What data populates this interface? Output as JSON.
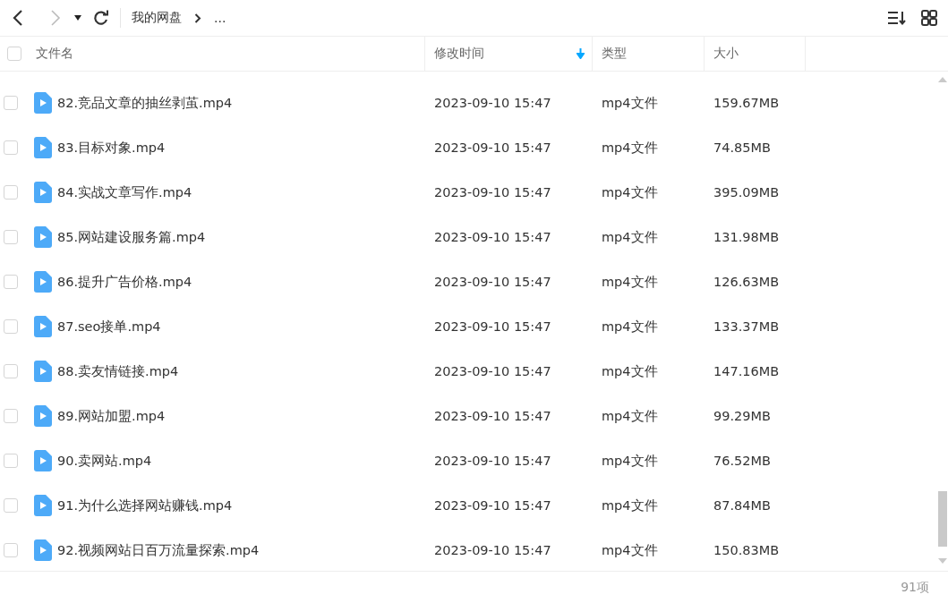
{
  "toolbar": {
    "back_disabled": false,
    "forward_disabled": true,
    "breadcrumb": [
      "我的网盘",
      "..."
    ]
  },
  "columns": [
    {
      "label": "文件名",
      "sorted": false
    },
    {
      "label": "修改时间",
      "sorted": true
    },
    {
      "label": "类型",
      "sorted": false
    },
    {
      "label": "大小",
      "sorted": false
    }
  ],
  "rows": [
    {
      "name": "82.竞品文章的抽丝剥茧.mp4",
      "modified": "2023-09-10 15:47",
      "type": "mp4文件",
      "size": "159.67MB",
      "checked": false
    },
    {
      "name": "83.目标对象.mp4",
      "modified": "2023-09-10 15:47",
      "type": "mp4文件",
      "size": "74.85MB",
      "checked": false
    },
    {
      "name": "84.实战文章写作.mp4",
      "modified": "2023-09-10 15:47",
      "type": "mp4文件",
      "size": "395.09MB",
      "checked": false
    },
    {
      "name": "85.网站建设服务篇.mp4",
      "modified": "2023-09-10 15:47",
      "type": "mp4文件",
      "size": "131.98MB",
      "checked": false
    },
    {
      "name": "86.提升广告价格.mp4",
      "modified": "2023-09-10 15:47",
      "type": "mp4文件",
      "size": "126.63MB",
      "checked": false
    },
    {
      "name": "87.seo接单.mp4",
      "modified": "2023-09-10 15:47",
      "type": "mp4文件",
      "size": "133.37MB",
      "checked": false
    },
    {
      "name": "88.卖友情链接.mp4",
      "modified": "2023-09-10 15:47",
      "type": "mp4文件",
      "size": "147.16MB",
      "checked": false
    },
    {
      "name": "89.网站加盟.mp4",
      "modified": "2023-09-10 15:47",
      "type": "mp4文件",
      "size": "99.29MB",
      "checked": false
    },
    {
      "name": "90.卖网站.mp4",
      "modified": "2023-09-10 15:47",
      "type": "mp4文件",
      "size": "76.52MB",
      "checked": false
    },
    {
      "name": "91.为什么选择网站赚钱.mp4",
      "modified": "2023-09-10 15:47",
      "type": "mp4文件",
      "size": "87.84MB",
      "checked": false
    },
    {
      "name": "92.视频网站日百万流量探索.mp4",
      "modified": "2023-09-10 15:47",
      "type": "mp4文件",
      "size": "150.83MB",
      "checked": false
    }
  ],
  "select_all_checked": false,
  "status_bar": {
    "count": "91项"
  }
}
